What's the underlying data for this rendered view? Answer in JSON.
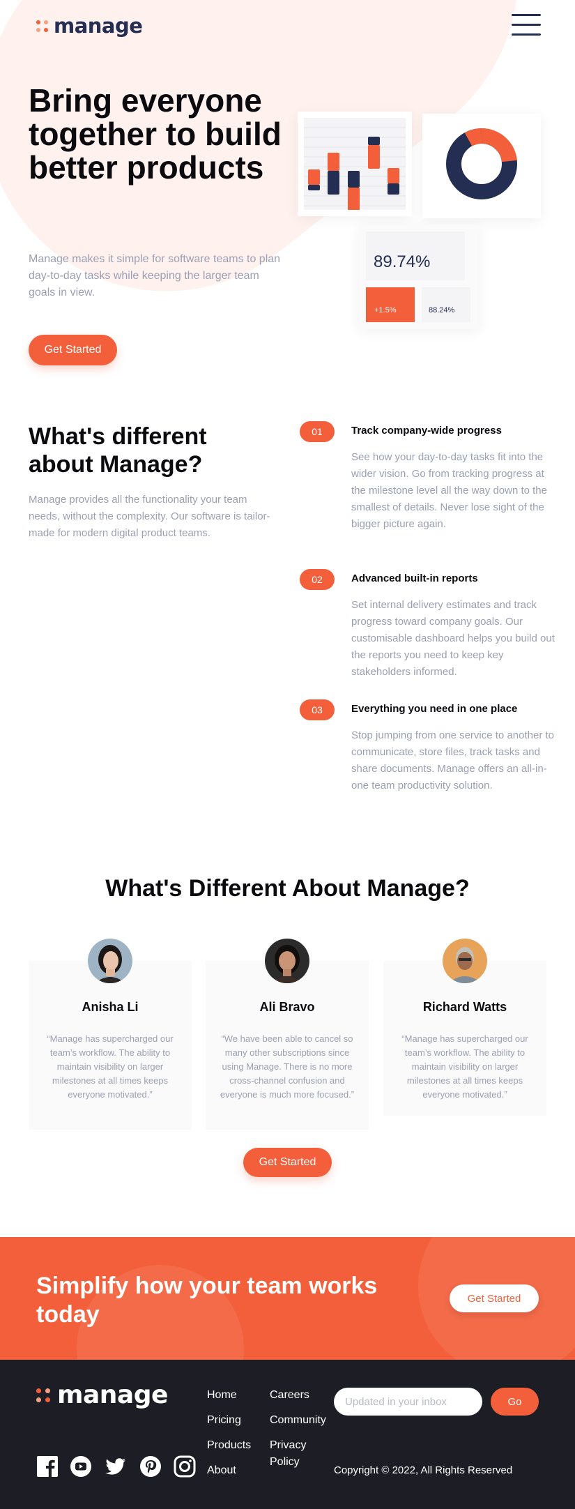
{
  "brand": {
    "logo_text": "manage",
    "accent_color": "#f25f3a",
    "dark_color": "#242d52"
  },
  "header": {
    "menu_icon": "hamburger-menu-icon"
  },
  "hero": {
    "title": "Bring everyone together to build better products",
    "description": "Manage makes it simple for software teams to plan day-to-day tasks while keeping the larger team goals in view.",
    "cta_label": "Get Started",
    "stats": {
      "main_value": "89.74%",
      "change_value": "+1.5%",
      "secondary_value": "88.24%"
    }
  },
  "different": {
    "title": "What's different about Manage?",
    "description": "Manage provides all the functionality your team needs, without the complexity. Our software is tailor-made for modern digital product teams.",
    "features": [
      {
        "number": "01",
        "title": "Track company-wide progress",
        "text": "See how your day-to-day tasks fit into the wider vision. Go from tracking progress at the milestone level all the way down to the smallest of details. Never lose sight of the bigger picture again."
      },
      {
        "number": "02",
        "title": "Advanced built-in reports",
        "text": "Set internal delivery estimates and track progress toward company goals. Our customisable dashboard helps you build out the reports you need to keep key stakeholders informed."
      },
      {
        "number": "03",
        "title": "Everything you need in one place",
        "text": "Stop jumping from one service to another to communicate, store files, track tasks and share documents. Manage offers an all-in-one team productivity solution."
      }
    ]
  },
  "testimonials": {
    "title": "What's Different About Manage?",
    "items": [
      {
        "name": "Anisha Li",
        "quote": "“Manage has supercharged our team’s workflow. The ability to maintain visibility on larger milestones at all times keeps everyone motivated.”"
      },
      {
        "name": "Ali Bravo",
        "quote": "“We have been able to cancel so many other subscriptions since using Manage. There is no more cross-channel confusion and everyone is much more focused.”"
      },
      {
        "name": "Richard Watts",
        "quote": "“Manage has supercharged our team’s workflow. The ability to maintain visibility on larger milestones at all times keeps everyone motivated.”"
      }
    ],
    "cta_label": "Get Started"
  },
  "cta": {
    "title": "Simplify how your team works today",
    "button_label": "Get Started"
  },
  "footer": {
    "logo_text": "manage",
    "links_col1": [
      "Home",
      "Pricing",
      "Products",
      "About"
    ],
    "links_col2": [
      "Careers",
      "Community",
      "Privacy Policy"
    ],
    "newsletter_placeholder": "Updated in your inbox",
    "go_label": "Go",
    "social_icons": [
      "facebook-icon",
      "youtube-icon",
      "twitter-icon",
      "pinterest-icon",
      "instagram-icon"
    ],
    "copyright": "Copyright © 2022, All Rights Reserved"
  }
}
